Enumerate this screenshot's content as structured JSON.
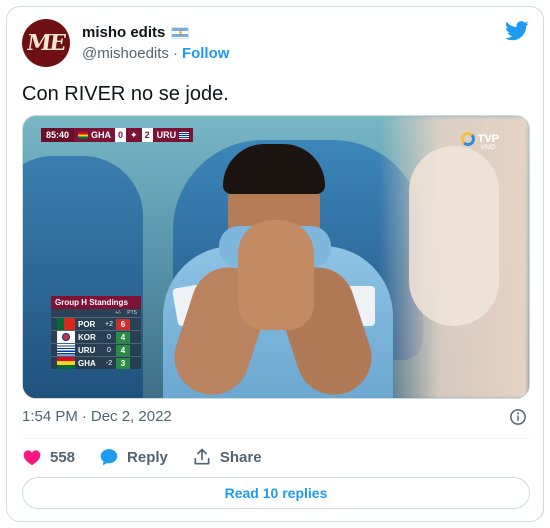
{
  "author": {
    "display_name": "misho edits",
    "handle": "@mishoedits",
    "follow_label": "Follow",
    "flag_icon": "argentina-flag-icon",
    "avatar_mark": "ME"
  },
  "tweet": {
    "text": "Con RIVER no se jode.",
    "time": "1:54 PM",
    "separator": "·",
    "date": "Dec 2, 2022"
  },
  "media": {
    "scorebar": {
      "clock": "85:40",
      "home": "GHA",
      "home_score": "0",
      "away_score": "2",
      "away": "URU"
    },
    "broadcaster": {
      "name": "TVP",
      "sub": "VIVO"
    },
    "standings": {
      "title": "Group H Standings",
      "col_gd": "+/-",
      "col_pts": "PTS",
      "rows": [
        {
          "team": "POR",
          "gd": "+2",
          "pts": "6"
        },
        {
          "team": "KOR",
          "gd": "0",
          "pts": "4"
        },
        {
          "team": "URU",
          "gd": "0",
          "pts": "4"
        },
        {
          "team": "GHA",
          "gd": "-2",
          "pts": "3"
        }
      ]
    }
  },
  "actions": {
    "likes": "558",
    "reply_label": "Reply",
    "share_label": "Share"
  },
  "read_replies_label": "Read 10 replies",
  "colors": {
    "accent": "#1d9bf0",
    "like": "#f91880",
    "muted": "#536471"
  }
}
